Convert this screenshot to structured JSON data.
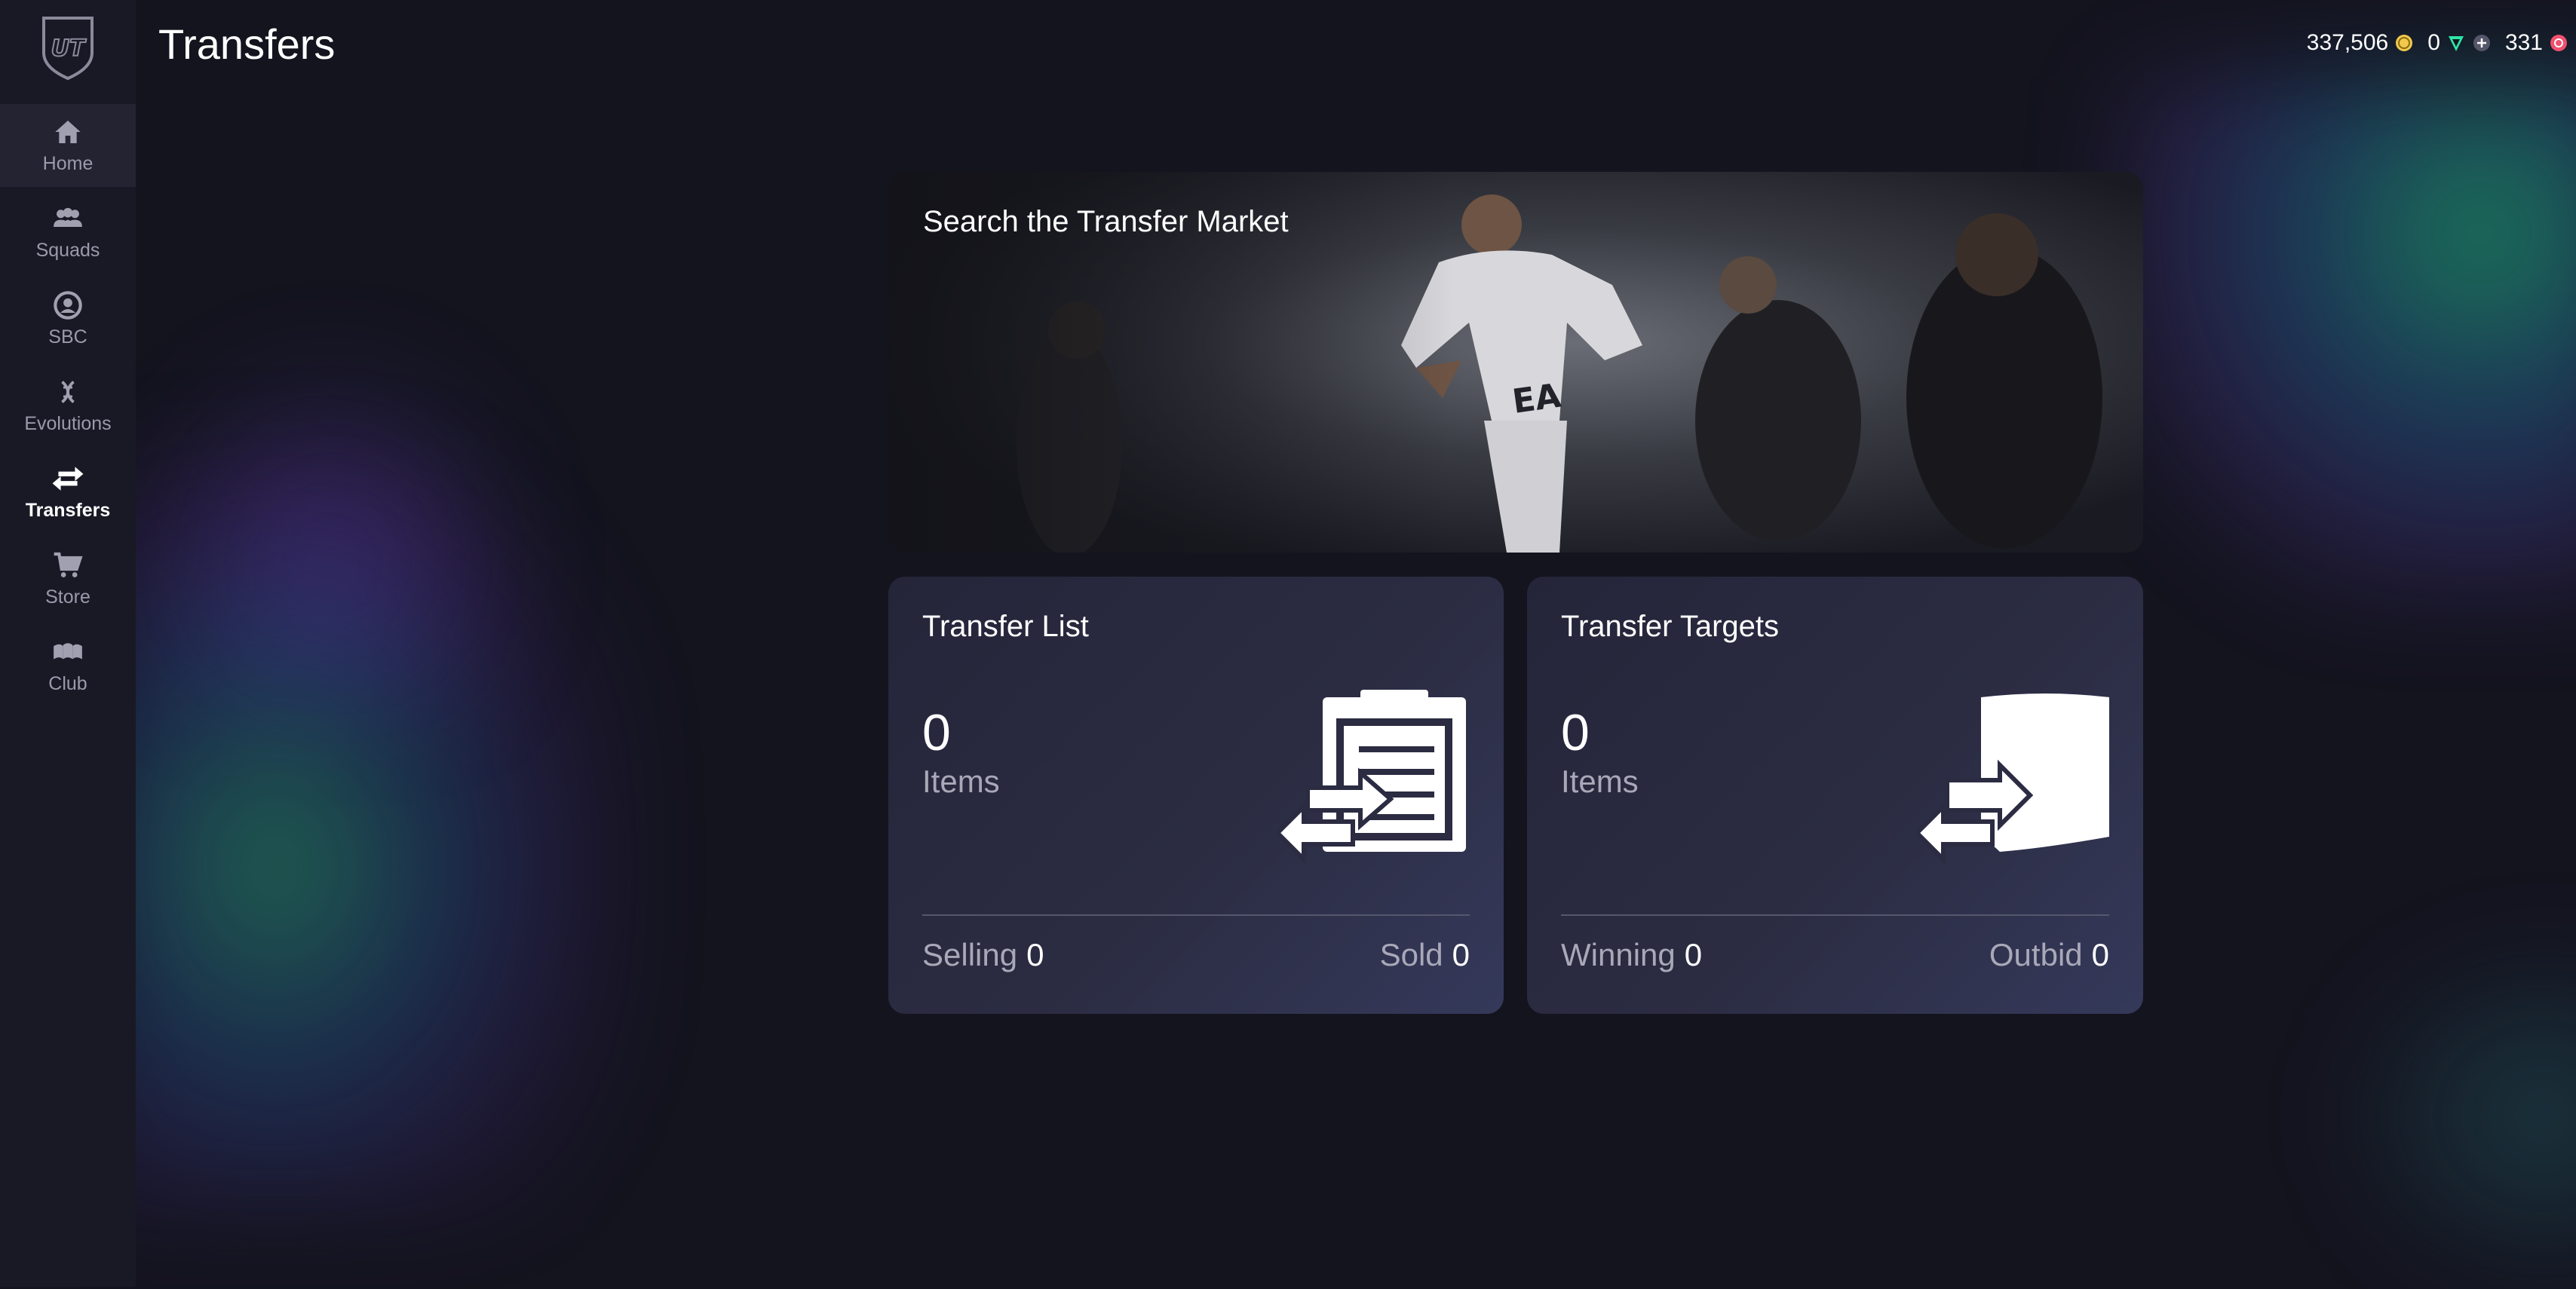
{
  "header": {
    "title": "Transfers"
  },
  "currency": {
    "coins": "337,506",
    "points": "0",
    "sbc_tokens": "331",
    "coin_color": "#f2c94c",
    "points_color": "#2ee6a6",
    "token_color": "#f0506e"
  },
  "sidebar": {
    "items": [
      {
        "label": "Home",
        "icon": "home-icon"
      },
      {
        "label": "Squads",
        "icon": "squads-icon"
      },
      {
        "label": "SBC",
        "icon": "sbc-icon"
      },
      {
        "label": "Evolutions",
        "icon": "evolutions-icon"
      },
      {
        "label": "Transfers",
        "icon": "transfers-icon"
      },
      {
        "label": "Store",
        "icon": "store-icon"
      },
      {
        "label": "Club",
        "icon": "club-icon"
      }
    ]
  },
  "search_market": {
    "title": "Search the Transfer Market"
  },
  "transfer_list": {
    "title": "Transfer List",
    "count": "0",
    "unit": "Items",
    "selling_label": "Selling",
    "selling_value": "0",
    "sold_label": "Sold",
    "sold_value": "0"
  },
  "transfer_targets": {
    "title": "Transfer Targets",
    "count": "0",
    "unit": "Items",
    "winning_label": "Winning",
    "winning_value": "0",
    "outbid_label": "Outbid",
    "outbid_value": "0"
  }
}
